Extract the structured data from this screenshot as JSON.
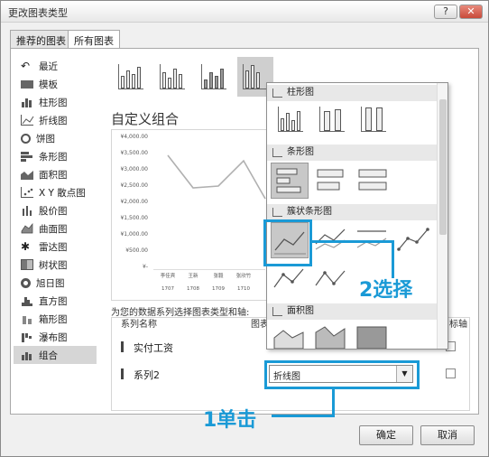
{
  "window": {
    "title": "更改图表类型",
    "help_label": "?",
    "close_label": "✕"
  },
  "tabs": [
    {
      "label": "推荐的图表",
      "active": false
    },
    {
      "label": "所有图表",
      "active": true
    }
  ],
  "sidebar": {
    "items": [
      {
        "label": "最近",
        "icon": "recent-icon"
      },
      {
        "label": "模板",
        "icon": "template-icon"
      },
      {
        "label": "柱形图",
        "icon": "column-chart-icon"
      },
      {
        "label": "折线图",
        "icon": "line-chart-icon"
      },
      {
        "label": "饼图",
        "icon": "pie-chart-icon"
      },
      {
        "label": "条形图",
        "icon": "bar-chart-icon"
      },
      {
        "label": "面积图",
        "icon": "area-chart-icon"
      },
      {
        "label": "X Y 散点图",
        "icon": "scatter-chart-icon"
      },
      {
        "label": "股价图",
        "icon": "stock-chart-icon"
      },
      {
        "label": "曲面图",
        "icon": "surface-chart-icon"
      },
      {
        "label": "雷达图",
        "icon": "radar-chart-icon"
      },
      {
        "label": "树状图",
        "icon": "treemap-icon"
      },
      {
        "label": "旭日图",
        "icon": "sunburst-icon"
      },
      {
        "label": "直方图",
        "icon": "histogram-icon"
      },
      {
        "label": "箱形图",
        "icon": "box-whisker-icon"
      },
      {
        "label": "瀑布图",
        "icon": "waterfall-icon"
      },
      {
        "label": "组合",
        "icon": "combo-chart-icon",
        "active": true
      }
    ]
  },
  "main": {
    "custom_title": "自定义组合",
    "preview": {
      "y_ticks": [
        "¥4,000.00",
        "¥3,500.00",
        "¥3,000.00",
        "¥2,500.00",
        "¥2,000.00",
        "¥1,500.00",
        "¥1,000.00",
        "¥500.00",
        "¥-"
      ],
      "x_names": [
        "李佳宾",
        "王新",
        "张毅",
        "张欣竹"
      ],
      "x_months": [
        "1707",
        "1708",
        "1709",
        "1710"
      ]
    },
    "assign_text": "为您的数据系列选择图表类型和轴:",
    "table": {
      "col_name": "系列名称",
      "col_type": "图表",
      "col_axis": "标轴",
      "rows": [
        {
          "name": "实付工资"
        },
        {
          "name": "系列2",
          "type": "折线图"
        }
      ]
    }
  },
  "dropdown": {
    "sections": [
      {
        "label": "柱形图"
      },
      {
        "label": "条形图"
      },
      {
        "label": "簇状条形图"
      },
      {
        "label": "面积图"
      }
    ]
  },
  "callouts": {
    "step1": "1单击",
    "step2": "2选择"
  },
  "footer": {
    "ok_label": "确定",
    "cancel_label": "取消"
  },
  "colors": {
    "highlight": "#1a9ad6",
    "selected": "#c8c8c8"
  }
}
